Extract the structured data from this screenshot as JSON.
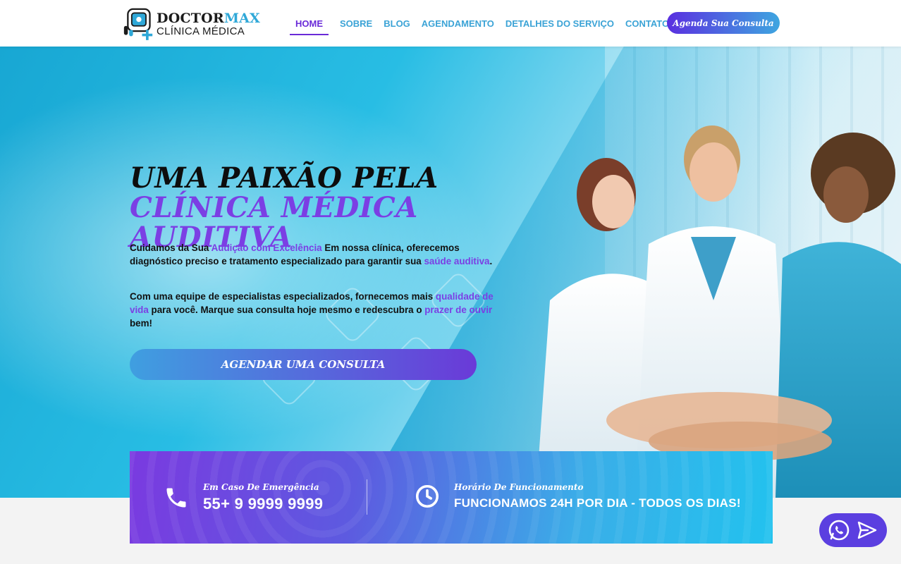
{
  "header": {
    "logo": {
      "title_main": "DOCTOR",
      "title_accent": "MAX",
      "subtitle": "CLÍNICA MÉDICA"
    },
    "nav": [
      {
        "label": "HOME",
        "active": true
      },
      {
        "label": "SOBRE"
      },
      {
        "label": "BLOG"
      },
      {
        "label": "AGENDAMENTO"
      },
      {
        "label": "DETALHES DO SERVIÇO"
      },
      {
        "label": "CONTATO"
      }
    ],
    "cta_label": "Agenda Sua Consulta"
  },
  "hero": {
    "headline_part1": "UMA PAIXÃO PELA ",
    "headline_part2": "CLÍNICA MÉDICA AUDITIVA",
    "p1": {
      "a": "Cuidamos da Sua ",
      "b": "Audição com Excelência",
      "c": " Em nossa clínica, oferecemos diagnóstico preciso e tratamento especializado para garantir sua ",
      "d": "saúde auditiva",
      "e": "."
    },
    "p2": {
      "a": "Com uma equipe de especialistas especializados, fornecemos mais ",
      "b": "qualidade de vida",
      "c": " para você. Marque sua consulta hoje mesmo e redescubra o ",
      "d": "prazer de ouvir",
      "e": " bem!"
    },
    "cta_label": "AGENDAR UMA CONSULTA"
  },
  "info": {
    "emergency": {
      "label": "Em Caso De Emergência",
      "value": "55+ 9 9999 9999",
      "icon": "phone-icon"
    },
    "hours": {
      "label": "Horário De Funcionamento",
      "value": "FUNCIONAMOS 24H POR DIA - TODOS OS DIAS!",
      "icon": "clock-icon"
    }
  },
  "float_widget": {
    "icons": [
      "whatsapp-icon",
      "send-icon"
    ]
  },
  "colors": {
    "accent_purple": "#7b3fe4",
    "accent_blue": "#3ba3d6"
  }
}
